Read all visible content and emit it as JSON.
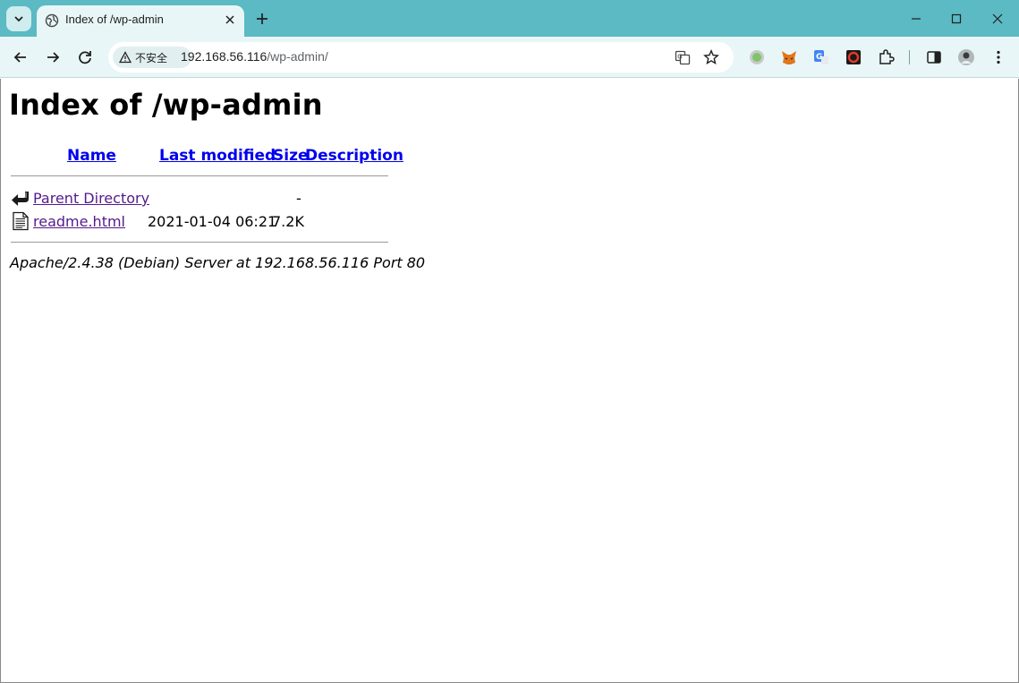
{
  "browser": {
    "tab": {
      "title": "Index of /wp-admin"
    },
    "omnibox": {
      "security_label": "不安全",
      "url_host": "192.168.56.116",
      "url_path": "/wp-admin/"
    },
    "colors": {
      "tabstrip": "#5bbac3",
      "toolbar": "#e9f6f7"
    }
  },
  "page": {
    "title": "Index of /wp-admin",
    "columns": [
      "Name",
      "Last modified",
      "Size",
      "Description"
    ],
    "rows": [
      {
        "icon": "back-arrow-icon",
        "name": "Parent Directory",
        "modified": "",
        "size": "-",
        "description": ""
      },
      {
        "icon": "text-file-icon",
        "name": "readme.html",
        "modified": "2021-01-04 06:21",
        "size": "7.2K",
        "description": ""
      }
    ],
    "address": "Apache/2.4.38 (Debian) Server at 192.168.56.116 Port 80"
  }
}
